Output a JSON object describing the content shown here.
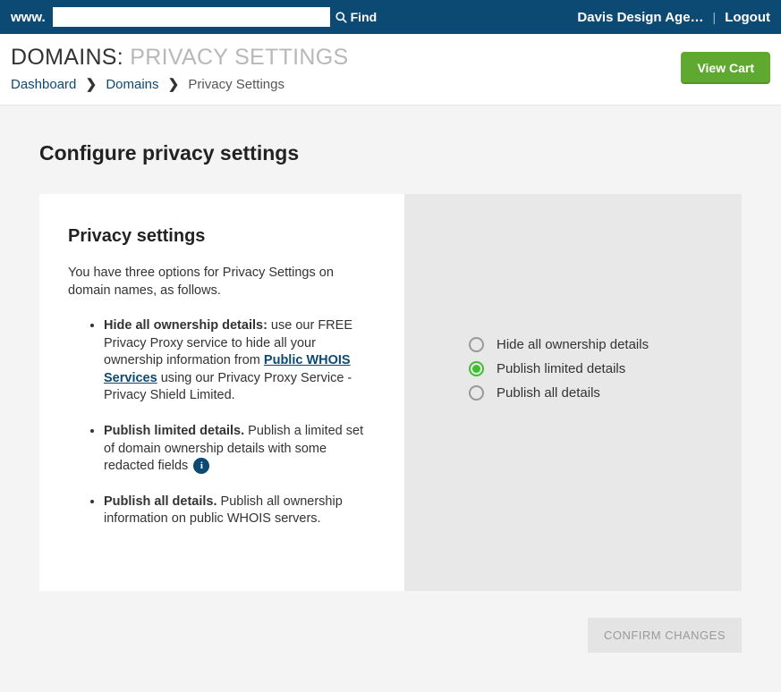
{
  "topbar": {
    "prefix": "www.",
    "search_value": "",
    "find_label": "Find",
    "user_name": "Davis Design Age…",
    "separator": "|",
    "logout_label": "Logout"
  },
  "header": {
    "title_prefix": "DOMAINS: ",
    "title_suffix": "PRIVACY SETTINGS",
    "view_cart_label": "View Cart"
  },
  "breadcrumb": {
    "items": [
      {
        "label": "Dashboard",
        "link": true
      },
      {
        "label": "Domains",
        "link": true
      },
      {
        "label": "Privacy Settings",
        "link": false
      }
    ],
    "chevron": "❯"
  },
  "main": {
    "heading": "Configure privacy settings",
    "panel_title": "Privacy settings",
    "intro": "You have three options for Privacy Settings on domain names, as follows.",
    "opt1_strong": "Hide all ownership details:",
    "opt1_pre": " use our FREE Privacy Proxy service to hide all your ownership information from ",
    "opt1_link": "Public WHOIS Services",
    "opt1_post": " using our Privacy Proxy Service - Privacy Shield Limited.",
    "opt2_strong": "Publish limited details.",
    "opt2_text": " Publish a limited set of domain ownership details with some redacted fields ",
    "opt3_strong": "Publish all details.",
    "opt3_text": " Publish all ownership information on public WHOIS servers.",
    "info_badge": "i"
  },
  "options": {
    "items": [
      {
        "label": "Hide all ownership details",
        "selected": false
      },
      {
        "label": "Publish limited details",
        "selected": true
      },
      {
        "label": "Publish all details",
        "selected": false
      }
    ]
  },
  "actions": {
    "confirm_label": "CONFIRM CHANGES"
  }
}
